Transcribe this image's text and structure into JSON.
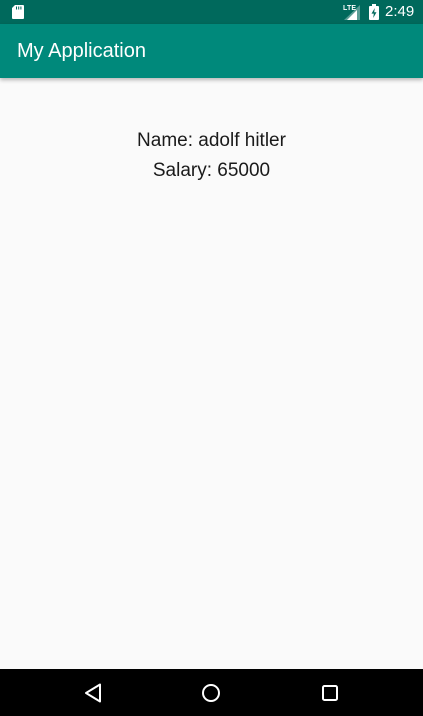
{
  "status_bar": {
    "network_type": "LTE",
    "time": "2:49",
    "icons": [
      "sd-card-icon",
      "cellular-signal-icon",
      "battery-charging-icon"
    ]
  },
  "app_bar": {
    "title": "My Application"
  },
  "content": {
    "name_line": "Name: adolf hitler",
    "salary_line": "Salary: 65000"
  },
  "nav_bar": {
    "icons": [
      "back-icon",
      "home-icon",
      "recents-icon"
    ]
  },
  "colors": {
    "status_bar": "#00695c",
    "app_bar": "#00897b",
    "background": "#fafafa",
    "text": "#1a1a1a",
    "nav_bar": "#000000"
  }
}
